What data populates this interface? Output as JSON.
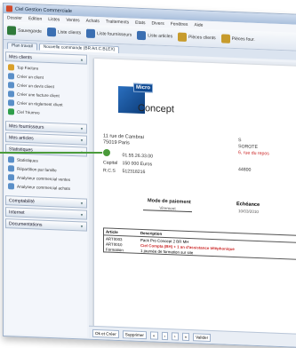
{
  "window": {
    "title": "Ciel Gestion Commerciale"
  },
  "menu": [
    "Dossier",
    "Edition",
    "Listes",
    "Ventes",
    "Achats",
    "Traitements",
    "Etats",
    "Divers",
    "Fenêtres",
    "Aide"
  ],
  "toolbar": [
    {
      "label": "Sauvegarde",
      "color": "#2f7a3a"
    },
    {
      "label": "Liste clients",
      "color": "#3b6fb2"
    },
    {
      "label": "Liste fournisseurs",
      "color": "#3b6fb2"
    },
    {
      "label": "Liste articles",
      "color": "#3b6fb2"
    },
    {
      "label": "Pièces clients",
      "color": "#c79b2c"
    },
    {
      "label": "Pièces four.",
      "color": "#c79b2c"
    }
  ],
  "tabs": [
    "Plan travail",
    "Nouvelle commande (BR Art.C.BLEX)"
  ],
  "sidebar": {
    "clients": {
      "title": "Mes clients",
      "items": [
        "Top Facture",
        "Créer un client",
        "Créer un devis client",
        "Créer une facture client",
        "Créer un règlement client",
        "Ciel Triumvo"
      ]
    },
    "fournisseurs": {
      "title": "Mes fournisseurs"
    },
    "articles": {
      "title": "Mes articles"
    },
    "statistiques": {
      "title": "Statistiques",
      "items": [
        "Statistiques",
        "Répartition par famille",
        "Analyseur commercial ventes",
        "Analyseur commercial achats"
      ]
    },
    "comptabilite": {
      "title": "Comptabilité"
    },
    "internet": {
      "title": "Internet"
    },
    "documentations": {
      "title": "Documentations"
    }
  },
  "document": {
    "logo_top": "Micro",
    "logo_bottom": "Concept",
    "address1": "11 rue de Cambrai",
    "address2": "75019 Paris",
    "tel_label": "Tél",
    "tel_value": "01.55.26.33.00",
    "capital_label": "Capital",
    "capital_value": "150 000 Euros",
    "rcs_label": "R.C.S",
    "rcs_value": "512318216",
    "right_name": "SOROTE",
    "right_addr": "6, rue du repos",
    "right_cp": "44800",
    "right_top": "S",
    "mode_title": "Mode de paiement",
    "mode_value": "Virement",
    "ech_title": "Echéance",
    "ech_value": "10/03/2010",
    "table_headers": [
      "Article",
      "Description"
    ],
    "table_rows": [
      [
        "ART0003",
        "Pack Pro Concept 2 BR MH"
      ],
      [
        "ART0010",
        "Ciel Compta (BH) + 1 an d'assistance téléphonique"
      ],
      [
        "Formation",
        "1 journée de formation sur site"
      ]
    ]
  },
  "bottom": {
    "btn1": "Ok et Créer",
    "btn2": "Supprimer",
    "btn3": "Valider"
  }
}
